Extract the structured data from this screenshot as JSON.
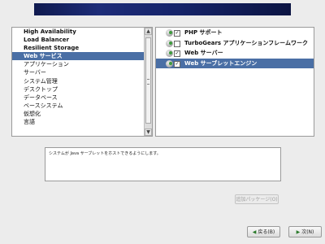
{
  "categories": [
    {
      "label": "High Availability",
      "bold": true,
      "selected": false
    },
    {
      "label": "Load Balancer",
      "bold": true,
      "selected": false
    },
    {
      "label": "Resilient Storage",
      "bold": true,
      "selected": false
    },
    {
      "label": "Web サービス",
      "bold": true,
      "selected": true
    },
    {
      "label": "アプリケーション",
      "bold": false,
      "selected": false
    },
    {
      "label": "サーバー",
      "bold": false,
      "selected": false
    },
    {
      "label": "システム管理",
      "bold": false,
      "selected": false
    },
    {
      "label": "デスクトップ",
      "bold": false,
      "selected": false
    },
    {
      "label": "データベース",
      "bold": false,
      "selected": false
    },
    {
      "label": "ベースシステム",
      "bold": false,
      "selected": false
    },
    {
      "label": "仮想化",
      "bold": false,
      "selected": false
    },
    {
      "label": "言語",
      "bold": false,
      "selected": false
    }
  ],
  "options": [
    {
      "label": "PHP サポート",
      "checked": true,
      "selected": false,
      "icon": "package-icon"
    },
    {
      "label": "TurboGears アプリケーションフレームワーク",
      "checked": false,
      "selected": false,
      "icon": "package-icon"
    },
    {
      "label": "Web サーバー",
      "checked": true,
      "selected": false,
      "icon": "package-icon"
    },
    {
      "label": "Web サーブレットエンジン",
      "checked": true,
      "selected": true,
      "icon": "package-icon"
    }
  ],
  "description": "システムが Java サーブレットをホストできるようにします。",
  "buttons": {
    "optional_packages": "追加パッケージ(O)",
    "back": "戻る(B)",
    "next": "次(N)"
  },
  "colors": {
    "banner": "#16246a",
    "selection": "#4a6fa5"
  }
}
